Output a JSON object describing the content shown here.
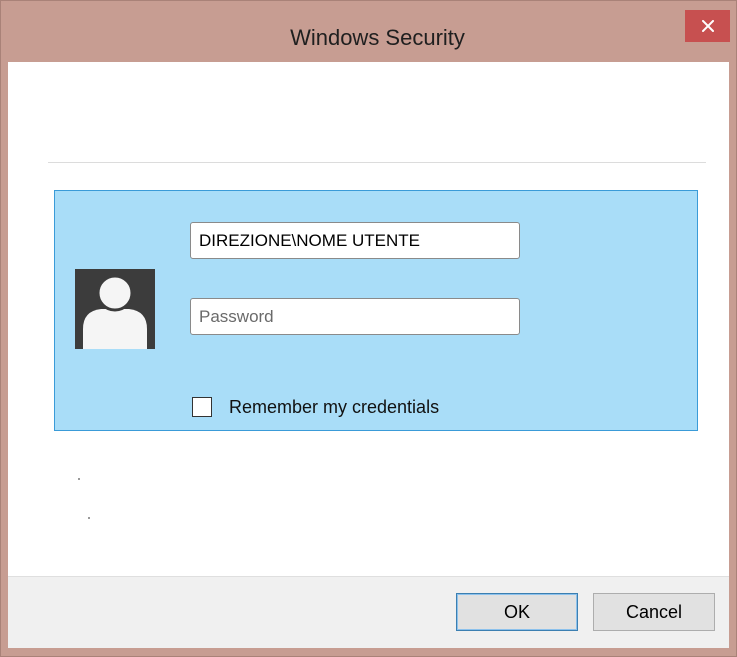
{
  "window": {
    "title": "Windows Security"
  },
  "credentials": {
    "username": "DIREZIONE\\NOME UTENTE",
    "password_placeholder": "Password",
    "password": "",
    "remember_label": "Remember my credentials",
    "remember_checked": false
  },
  "buttons": {
    "ok": "OK",
    "cancel": "Cancel"
  },
  "icons": {
    "close": "close-icon",
    "avatar": "user-icon"
  },
  "colors": {
    "frame": "#c79d92",
    "close_button": "#c75050",
    "panel": "#a9ddf8",
    "panel_border": "#3a9bd8",
    "avatar": "#3c3c3c",
    "default_button_border": "#3c7fb1"
  }
}
